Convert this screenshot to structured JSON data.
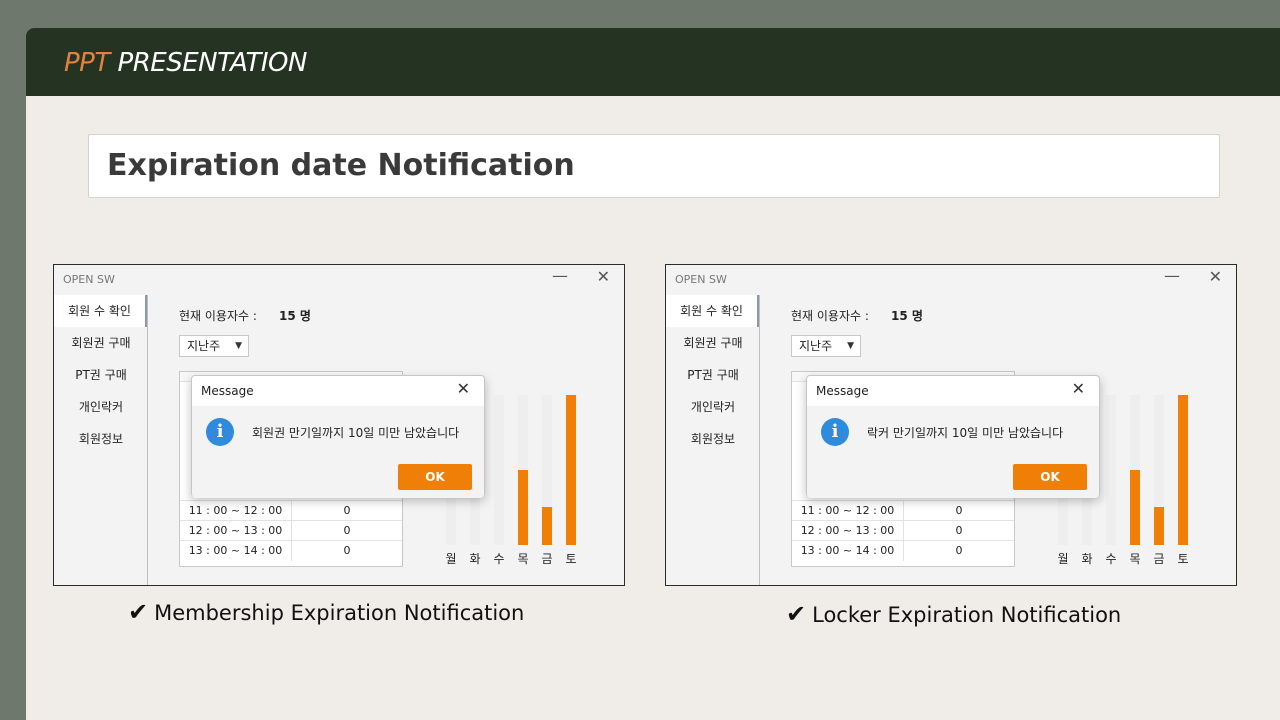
{
  "header": {
    "accent": "PPT",
    "title": "PRESENTATION",
    "background": "#253322",
    "accent_color": "#e2833d"
  },
  "slide_title": "Expiration date Notification",
  "app": {
    "window_title": "OPEN SW",
    "minimize_icon": "minimize-icon",
    "close_icon": "close-icon",
    "sidebar": [
      "회원 수 확인",
      "회원권 구매",
      "PT권 구매",
      "개인락커",
      "회원정보"
    ],
    "count_label": "현재 이용자수 :",
    "count_value": "15 명",
    "dropdown_value": "지난주",
    "table_rows": [
      {
        "time": "11 : 00 ~ 12 : 00",
        "count": "0"
      },
      {
        "time": "12 : 00 ~ 13 : 00",
        "count": "0"
      },
      {
        "time": "13 : 00 ~ 14 : 00",
        "count": "0"
      }
    ],
    "accent_color": "#f07f08"
  },
  "chart_data": {
    "type": "bar",
    "categories": [
      "월",
      "화",
      "수",
      "목",
      "금",
      "토"
    ],
    "values": [
      0,
      0,
      0,
      6,
      3,
      12
    ],
    "ylim": [
      0,
      12
    ],
    "grid": false
  },
  "left_panel": {
    "dialog_title": "Message",
    "dialog_message": "회원권 만기일까지 10일 미만 남았습니다",
    "ok_label": "OK",
    "caption": "Membership Expiration Notification"
  },
  "right_panel": {
    "dialog_title": "Message",
    "dialog_message": "락커 만기일까지 10일 미만 남았습니다",
    "ok_label": "OK",
    "caption": "Locker Expiration Notification"
  },
  "check_glyph": "✔"
}
